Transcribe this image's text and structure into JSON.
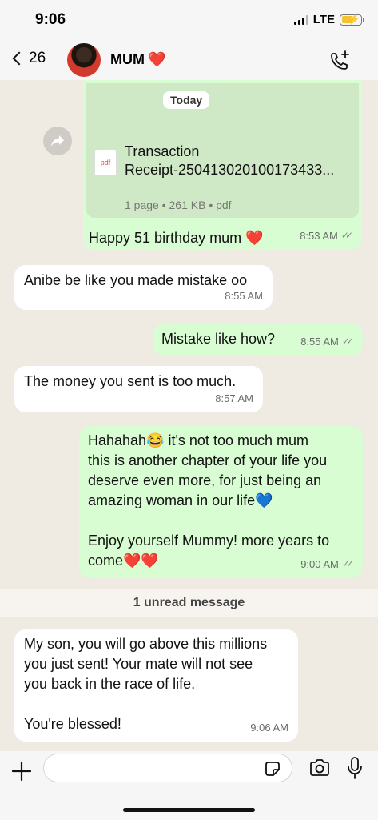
{
  "status_bar": {
    "time": "9:06",
    "network": "LTE"
  },
  "header": {
    "back_count": "26",
    "contact_name": "MUM",
    "name_emoji": "❤️"
  },
  "chat": {
    "date_chip": "Today",
    "document": {
      "type_label": "pdf",
      "title_line1": "Transaction",
      "title_line2": "Receipt-250413020100173433...",
      "meta": "1 page • 261 KB • pdf",
      "caption": "Happy 51 birthday mum ❤️",
      "time": "8:53 AM"
    },
    "messages": [
      {
        "text": "Anibe be like you made mistake oo",
        "time": "8:55 AM"
      },
      {
        "text": "Mistake like how?",
        "time": "8:55 AM"
      },
      {
        "text": "The money you sent is too much.",
        "time": "8:57 AM"
      },
      {
        "line1": "Hahahah😂 it's not too much mum",
        "line2": "this is another chapter of your life you",
        "line3": "deserve even more, for just being an",
        "line4": "amazing woman in our life💙",
        "line5": "Enjoy yourself Mummy! more years to",
        "line6": "come❤️❤️",
        "time": "9:00 AM"
      },
      {
        "line1": "My son, you will go above this millions",
        "line2": "you just sent! Your mate will not see",
        "line3": "you back in the race of life.",
        "line4": "You're blessed!",
        "time": "9:06 AM"
      }
    ],
    "unread_label": "1 unread message"
  },
  "composer": {
    "placeholder": ""
  },
  "icons": {
    "back": "chevron-left-icon",
    "call": "add-call-icon",
    "forward": "forward-icon",
    "plus": "plus-icon",
    "sticker": "sticker-icon",
    "camera": "camera-icon",
    "mic": "microphone-icon"
  },
  "colors": {
    "outgoing_bubble": "#d9fdd3",
    "incoming_bubble": "#ffffff",
    "chat_bg": "#efeae2"
  }
}
